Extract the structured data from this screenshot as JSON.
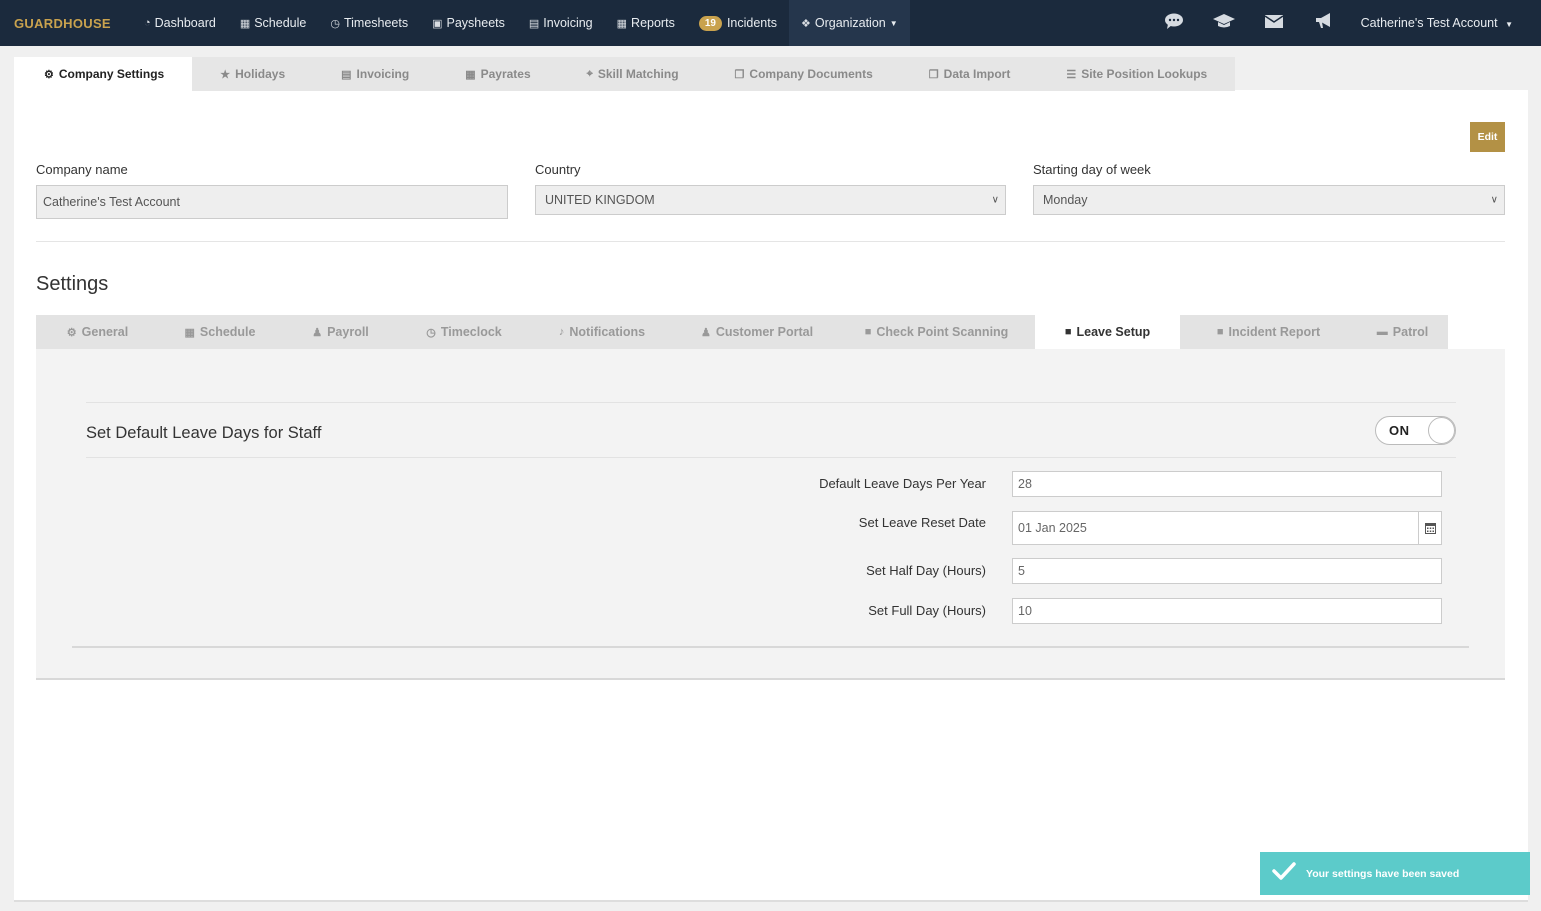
{
  "navbar": {
    "brand": "GUARDHOUSE",
    "items": [
      {
        "label": "Dashboard",
        "icon": "dashboard-icon",
        "glyph": "◔"
      },
      {
        "label": "Schedule",
        "icon": "calendar-icon",
        "glyph": "▦"
      },
      {
        "label": "Timesheets",
        "icon": "clock-icon",
        "glyph": "◷"
      },
      {
        "label": "Paysheets",
        "icon": "money-icon",
        "glyph": "▣"
      },
      {
        "label": "Invoicing",
        "icon": "invoice-icon",
        "glyph": "▤"
      },
      {
        "label": "Reports",
        "icon": "table-icon",
        "glyph": "▦"
      },
      {
        "label": "Incidents",
        "badge": "19"
      },
      {
        "label": "Organization",
        "icon": "users-icon",
        "glyph": "❖",
        "active": true
      }
    ],
    "right_icons": [
      "chat-icon",
      "graduation-cap-icon",
      "envelope-icon",
      "megaphone-icon"
    ],
    "account": "Catherine's Test Account"
  },
  "top_tabs": [
    {
      "label": "Company Settings",
      "icon": "gear-icon",
      "glyph": "⚙",
      "active": true
    },
    {
      "label": "Holidays",
      "icon": "star-icon",
      "glyph": "★"
    },
    {
      "label": "Invoicing",
      "icon": "invoice-icon",
      "glyph": "▤"
    },
    {
      "label": "Payrates",
      "icon": "calendar-icon",
      "glyph": "▦"
    },
    {
      "label": "Skill Matching",
      "icon": "crosshair-icon",
      "glyph": "⌖"
    },
    {
      "label": "Company Documents",
      "icon": "copy-icon",
      "glyph": "❐"
    },
    {
      "label": "Data Import",
      "icon": "copy-icon",
      "glyph": "❐"
    },
    {
      "label": "Site Position Lookups",
      "icon": "list-icon",
      "glyph": "☰"
    }
  ],
  "edit_button": "Edit",
  "company": {
    "name_label": "Company name",
    "name_value": "Catherine's Test Account",
    "country_label": "Country",
    "country_value": "UNITED KINGDOM",
    "start_day_label": "Starting day of week",
    "start_day_value": "Monday"
  },
  "settings_title": "Settings",
  "sub_tabs": [
    {
      "label": "General",
      "icon": "gear-icon",
      "glyph": "⚙"
    },
    {
      "label": "Schedule",
      "icon": "calendar-icon",
      "glyph": "▦"
    },
    {
      "label": "Payroll",
      "icon": "user-icon",
      "glyph": "♟"
    },
    {
      "label": "Timeclock",
      "icon": "clock-icon",
      "glyph": "◷"
    },
    {
      "label": "Notifications",
      "icon": "bell-icon",
      "glyph": "♪"
    },
    {
      "label": "Customer Portal",
      "icon": "user-icon",
      "glyph": "♟"
    },
    {
      "label": "Check Point Scanning",
      "icon": "file-icon",
      "glyph": "■"
    },
    {
      "label": "Leave Setup",
      "icon": "file-icon",
      "glyph": "■",
      "active": true
    },
    {
      "label": "Incident Report",
      "icon": "file-icon",
      "glyph": "■"
    },
    {
      "label": "Patrol",
      "icon": "car-icon",
      "glyph": "▬"
    }
  ],
  "leave": {
    "title": "Set Default Leave Days for Staff",
    "toggle": "ON",
    "rows": [
      {
        "label": "Default Leave Days Per Year",
        "value": "28"
      },
      {
        "label": "Set Leave Reset Date",
        "value": "01 Jan 2025"
      },
      {
        "label": "Set Half Day (Hours)",
        "value": "5"
      },
      {
        "label": "Set Full Day (Hours)",
        "value": "10"
      }
    ]
  },
  "toast": "Your settings have been saved"
}
